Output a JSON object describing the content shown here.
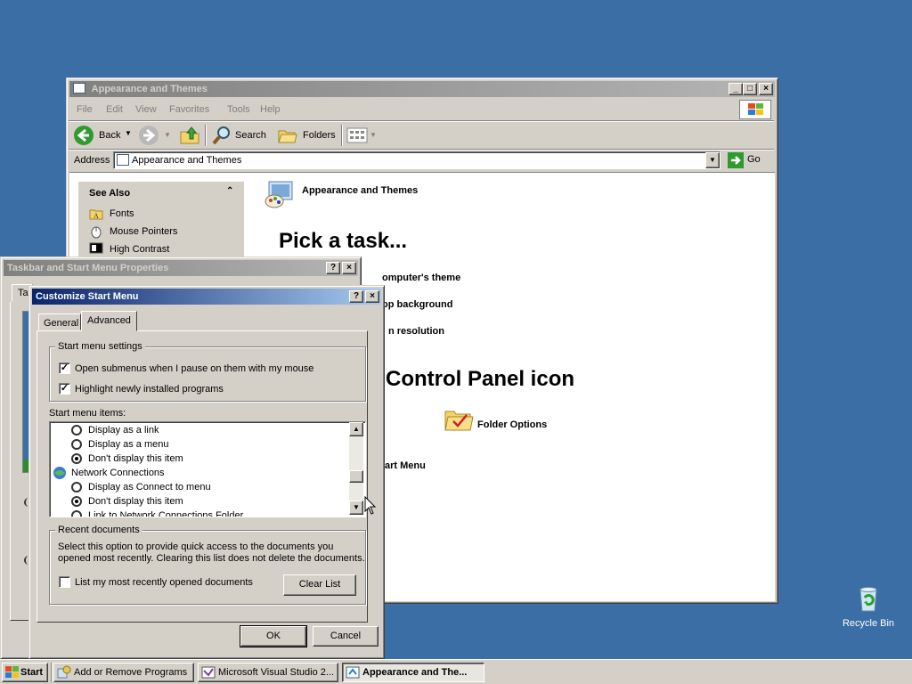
{
  "desktop": {
    "recycle_bin_label": "Recycle Bin"
  },
  "explorer": {
    "title": "Appearance and Themes",
    "menu": [
      "File",
      "Edit",
      "View",
      "Favorites",
      "Tools",
      "Help"
    ],
    "toolbar": {
      "back": "Back",
      "search": "Search",
      "folders": "Folders"
    },
    "address_label": "Address",
    "address_value": "Appearance and Themes",
    "go_label": "Go",
    "see_also": {
      "title": "See Also",
      "items": [
        "Fonts",
        "Mouse Pointers",
        "High Contrast"
      ]
    },
    "header": "Appearance and Themes",
    "pick_task": "Pick a task...",
    "tasks": [
      "omputer's theme",
      "op background",
      "n resolution"
    ],
    "pick_icon": "Control Panel icon",
    "icons": [
      "Folder Options",
      "art Menu"
    ]
  },
  "taskbar_props": {
    "title": "Taskbar and Start Menu Properties",
    "tab_partial": "Ta"
  },
  "customize": {
    "title": "Customize Start Menu",
    "tabs": [
      "General",
      "Advanced"
    ],
    "start_menu_settings": {
      "label": "Start menu settings",
      "options": [
        {
          "label": "Open submenus when I pause on them with my mouse",
          "checked": true
        },
        {
          "label": "Highlight newly installed programs",
          "checked": true
        }
      ]
    },
    "items_label": "Start menu items:",
    "list": [
      {
        "type": "radio",
        "label": "Display as a link",
        "on": false
      },
      {
        "type": "radio",
        "label": "Display as a menu",
        "on": false
      },
      {
        "type": "radio",
        "label": "Don't display this item",
        "on": true
      },
      {
        "type": "header",
        "label": "Network Connections"
      },
      {
        "type": "radio",
        "label": "Display as Connect to menu",
        "on": false
      },
      {
        "type": "radio",
        "label": "Don't display this item",
        "on": true
      },
      {
        "type": "radio",
        "label": "Link to Network Connections Folder",
        "on": false
      }
    ],
    "recent": {
      "label": "Recent documents",
      "description_1": "Select this option to provide quick access to the documents you",
      "description_2": "opened most recently.  Clearing this list does not delete the documents.",
      "checkbox_label": "List my most recently opened documents",
      "checked": false,
      "clear_button": "Clear List"
    },
    "ok": "OK",
    "cancel": "Cancel"
  },
  "taskbar": {
    "start": "Start",
    "tasks": [
      "Add or Remove Programs",
      "Microsoft Visual Studio 2...",
      "Appearance and The..."
    ]
  }
}
